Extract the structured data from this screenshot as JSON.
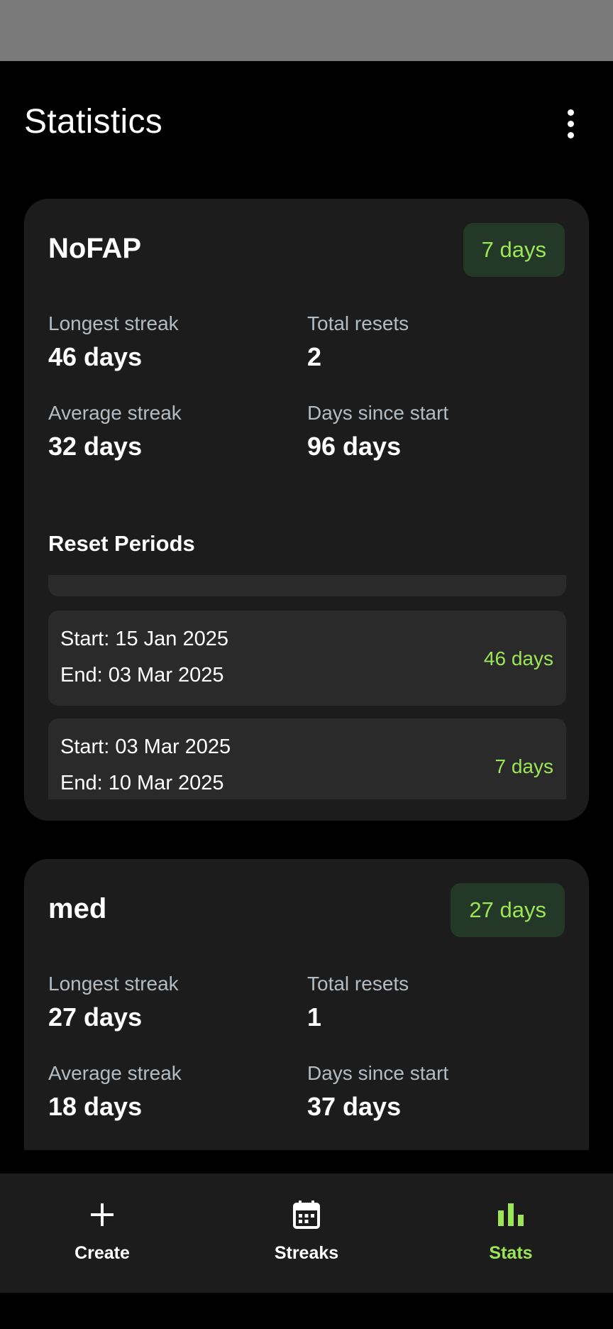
{
  "header": {
    "title": "Statistics"
  },
  "colors": {
    "accent": "#9be657",
    "chip_bg": "#243828",
    "card_bg": "#1c1c1c"
  },
  "habits": [
    {
      "name": "NoFAP",
      "current_streak": "7 days",
      "stats": {
        "longest_label": "Longest streak",
        "longest_value": "46 days",
        "resets_label": "Total resets",
        "resets_value": "2",
        "average_label": "Average streak",
        "average_value": "32 days",
        "since_label": "Days since start",
        "since_value": "96 days"
      },
      "reset_periods_title": "Reset Periods",
      "periods": [
        {
          "start": "Start: 15 Jan 2025",
          "end": "End: 03 Mar 2025",
          "duration": "46 days"
        },
        {
          "start": "Start: 03 Mar 2025",
          "end": "End: 10 Mar 2025",
          "duration": "7 days"
        }
      ]
    },
    {
      "name": "med",
      "current_streak": "27 days",
      "stats": {
        "longest_label": "Longest streak",
        "longest_value": "27 days",
        "resets_label": "Total resets",
        "resets_value": "1",
        "average_label": "Average streak",
        "average_value": "18 days",
        "since_label": "Days since start",
        "since_value": "37 days"
      }
    }
  ],
  "nav": {
    "items": [
      {
        "label": "Create",
        "icon": "plus-icon"
      },
      {
        "label": "Streaks",
        "icon": "calendar-icon"
      },
      {
        "label": "Stats",
        "icon": "bar-chart-icon",
        "active": true
      }
    ]
  }
}
